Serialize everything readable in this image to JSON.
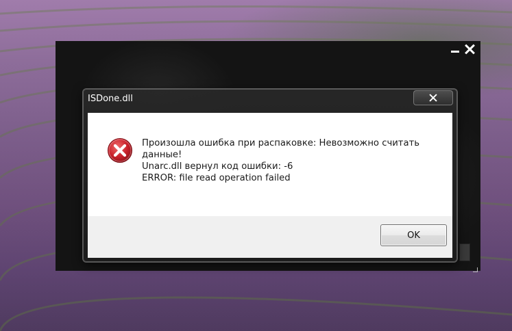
{
  "dialog": {
    "title": "ISDone.dll",
    "message_lines": [
      "Произошла ошибка при распаковке: Невозможно считать данные!",
      "Unarc.dll вернул код ошибки: -6",
      "ERROR: file read operation failed"
    ],
    "ok_label": "OK",
    "icon": "error-icon"
  },
  "background_window": {
    "controls": [
      "minimize-icon",
      "close-icon"
    ]
  },
  "colors": {
    "error_red": "#c8202a",
    "dialog_frame": "#2a2a2a",
    "content_bg": "#ffffff",
    "footer_bg": "#f0f0f0"
  }
}
